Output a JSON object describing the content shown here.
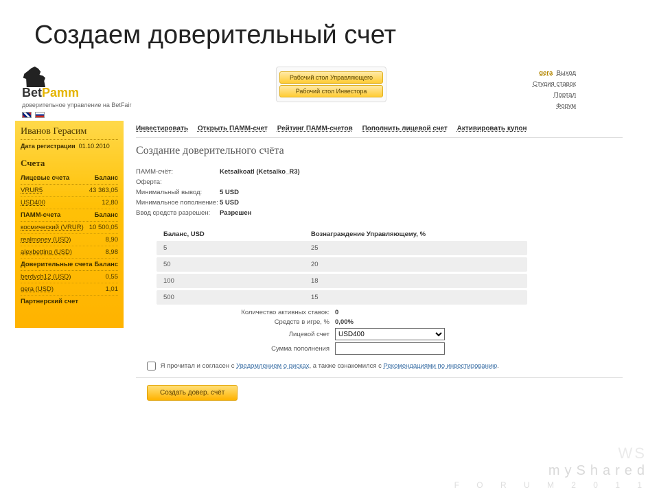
{
  "slide_title": "Создаем доверительный счет",
  "logo": {
    "name": "BetPamm",
    "name_accent": "Bet",
    "name_rest": "Pamm",
    "tagline": "доверительное управление на BetFair"
  },
  "top_buttons": {
    "manager": "Рабочий стол Управляющего",
    "investor": "Рабочий стол Инвестора"
  },
  "user": {
    "name": "gera",
    "links": {
      "logout": "Выход",
      "studio": "Студия ставок",
      "portal": "Портал",
      "forum": "Форум"
    }
  },
  "sidebar": {
    "username": "Иванов Герасим",
    "reg_label": "Дата регистрации",
    "reg_date": "01.10.2010",
    "section_title": "Счета",
    "balance_label": "Баланс",
    "personal_label": "Лицевые счета",
    "pamm_label": "ПАММ-счета",
    "trust_label": "Доверительные счета",
    "partner_label": "Партнерский счет",
    "personal": [
      {
        "label": "VRUR5",
        "value": "43 363,05"
      },
      {
        "label": "USD400",
        "value": "12,80"
      }
    ],
    "pamm": [
      {
        "label": "космический (VRUR)",
        "value": "10 500,05"
      },
      {
        "label": "realmoney (USD)",
        "value": "8,90"
      },
      {
        "label": "alexbetting (USD)",
        "value": "8,98"
      }
    ],
    "trust": [
      {
        "label": "berdych12 (USD)",
        "value": "0,55"
      },
      {
        "label": "gera (USD)",
        "value": "1,01"
      }
    ]
  },
  "tabs": {
    "t1": "Инвестировать",
    "t2": "Открыть ПАММ-счет",
    "t3": "Рейтинг ПАММ-счетов",
    "t4": "Пополнить лицевой счет",
    "t5": "Активировать купон"
  },
  "page_heading": "Создание доверительного счёта",
  "info": {
    "pamm_label": "ПАММ-счёт:",
    "pamm_value": "Ketsalkoatl (Ketsalko_R3)",
    "offer_label": "Оферта:",
    "offer_value": "",
    "minout_label": "Минимальный вывод:",
    "minout_value": "5 USD",
    "minin_label": "Минимальное пополнение:",
    "minin_value": "5 USD",
    "perm_label": "Ввод средств разрешен:",
    "perm_value": "Разрешен"
  },
  "tiers": {
    "h1": "Баланс, USD",
    "h2": "Вознаграждение Управляющему, %",
    "rows": [
      {
        "b": "5",
        "r": "25"
      },
      {
        "b": "50",
        "r": "20"
      },
      {
        "b": "100",
        "r": "18"
      },
      {
        "b": "500",
        "r": "15"
      }
    ]
  },
  "form": {
    "active_bets_label": "Количество активных ставок:",
    "active_bets_value": "0",
    "funds_in_play_label": "Средств в игре, %",
    "funds_in_play_value": "0,00%",
    "personal_acc_label": "Лицевой счет",
    "personal_acc_value": "USD400",
    "amount_label": "Сумма пополнения"
  },
  "agree": {
    "pre": "Я прочитал и согласен с ",
    "risk": "Уведомлением о рисках",
    "mid": ", а также ознакомился с ",
    "rec": "Рекомендациями по инвестированию",
    "post": "."
  },
  "submit": "Создать довер. счёт",
  "wm": {
    "a": "WS",
    "b": "myShared",
    "c": "F O R U M   2 0 1 1"
  }
}
